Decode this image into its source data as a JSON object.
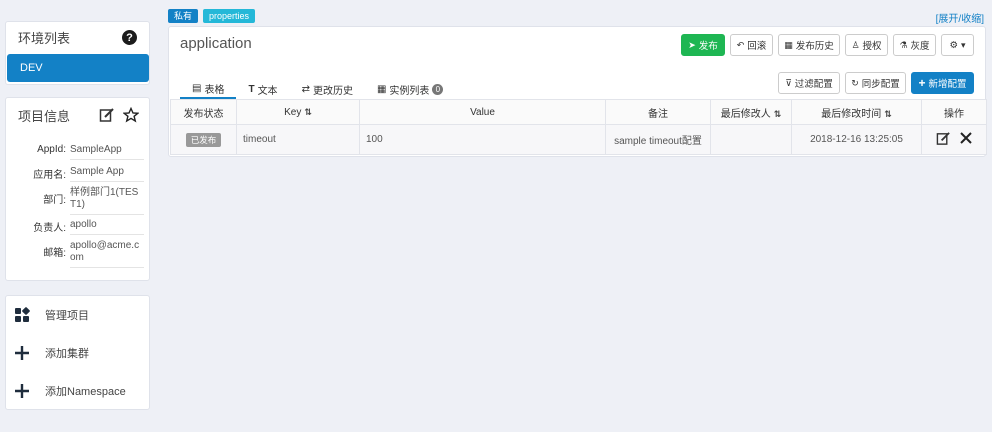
{
  "env": {
    "title": "环境列表",
    "items": [
      {
        "label": "DEV"
      }
    ]
  },
  "info": {
    "title": "项目信息",
    "fields": [
      {
        "label": "AppId:",
        "value": "SampleApp"
      },
      {
        "label": "应用名:",
        "value": "Sample App"
      },
      {
        "label": "部门:",
        "value": "样例部门1(TEST1)"
      },
      {
        "label": "负责人:",
        "value": "apollo"
      },
      {
        "label": "邮箱:",
        "value": "apollo@acme.com"
      }
    ]
  },
  "actions": {
    "items": [
      {
        "label": "管理项目"
      },
      {
        "label": "添加集群"
      },
      {
        "label": "添加Namespace"
      }
    ]
  },
  "namespace": {
    "badges": {
      "private": "私有",
      "format": "properties"
    },
    "expand": "[展开/收缩]",
    "title": "application",
    "buttons": {
      "release": "发布",
      "rollback": "回滚",
      "history": "发布历史",
      "grant": "授权",
      "gray": "灰度"
    },
    "tabs": [
      {
        "label": "表格"
      },
      {
        "label": "文本"
      },
      {
        "label": "更改历史"
      },
      {
        "label": "实例列表",
        "count": "0"
      }
    ],
    "tools": {
      "filter": "过滤配置",
      "sync": "同步配置",
      "add": "新增配置"
    },
    "table": {
      "headers": {
        "status": "发布状态",
        "key": "Key",
        "value": "Value",
        "comment": "备注",
        "modifier": "最后修改人",
        "time": "最后修改时间",
        "ops": "操作"
      },
      "rows": [
        {
          "status": "已发布",
          "key": "timeout",
          "value": "100",
          "comment": "sample timeout配置",
          "modifier": "",
          "time": "2018-12-16 13:25:05"
        }
      ]
    }
  },
  "colors": {
    "primary": "#1381c6",
    "release": "#1eb653",
    "properties_badge": "#24b8d8"
  }
}
